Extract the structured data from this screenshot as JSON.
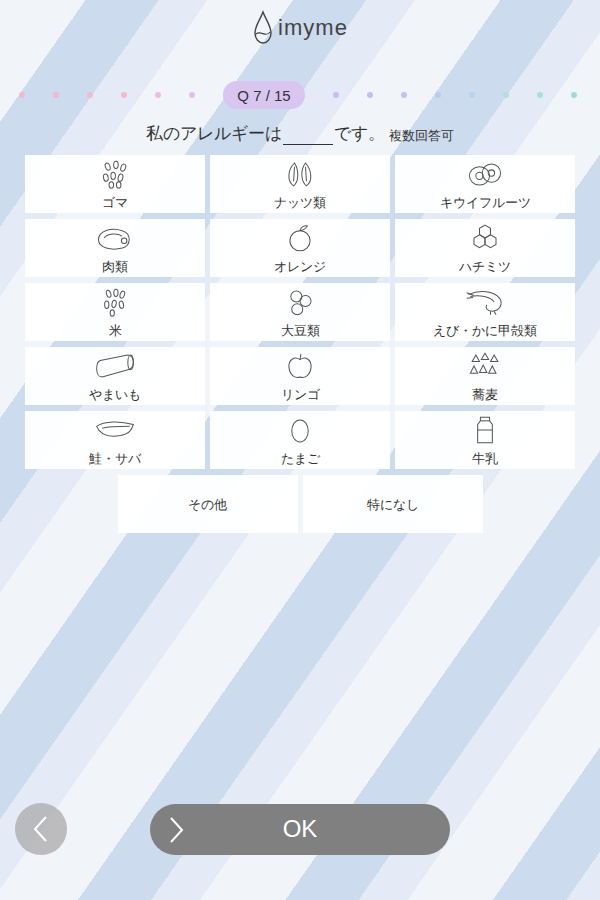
{
  "logo": {
    "text": "imyme"
  },
  "progress": {
    "label": "Q 7 / 15",
    "current_index": 6,
    "dots": [
      {
        "color": "#f3b9d1"
      },
      {
        "color": "#f3b9d1"
      },
      {
        "color": "#f3b9d1"
      },
      {
        "color": "#f3b9d1"
      },
      {
        "color": "#efbde0"
      },
      {
        "color": "#e6bfe9"
      },
      {
        "color": "#cbbcef"
      },
      {
        "color": "#c6bdf0"
      },
      {
        "color": "#c2c1f0"
      },
      {
        "color": "#bdc9ef"
      },
      {
        "color": "#b8d3ec"
      },
      {
        "color": "#b0e0e2"
      },
      {
        "color": "#a6e2dc"
      },
      {
        "color": "#9edcd5"
      }
    ]
  },
  "question": {
    "before": "私のアレルギーは",
    "after": "です。",
    "note": "複数回答可"
  },
  "options": [
    {
      "label": "ゴマ",
      "selected": false
    },
    {
      "label": "ナッツ類",
      "selected": false
    },
    {
      "label": "キウイフルーツ",
      "selected": false
    },
    {
      "label": "肉類",
      "selected": false
    },
    {
      "label": "オレンジ",
      "selected": false
    },
    {
      "label": "ハチミツ",
      "selected": false
    },
    {
      "label": "米",
      "selected": false
    },
    {
      "label": "大豆類",
      "selected": false
    },
    {
      "label": "えび・かに甲殻類",
      "selected": false
    },
    {
      "label": "やまいも",
      "selected": false
    },
    {
      "label": "リンゴ",
      "selected": false
    },
    {
      "label": "蕎麦",
      "selected": false
    },
    {
      "label": "鮭・サバ",
      "selected": false
    },
    {
      "label": "たまご",
      "selected": false
    },
    {
      "label": "牛乳",
      "selected": false
    }
  ],
  "extra_options": [
    {
      "label": "その他",
      "selected": false
    },
    {
      "label": "特になし",
      "selected": false
    }
  ],
  "buttons": {
    "ok": "OK"
  }
}
